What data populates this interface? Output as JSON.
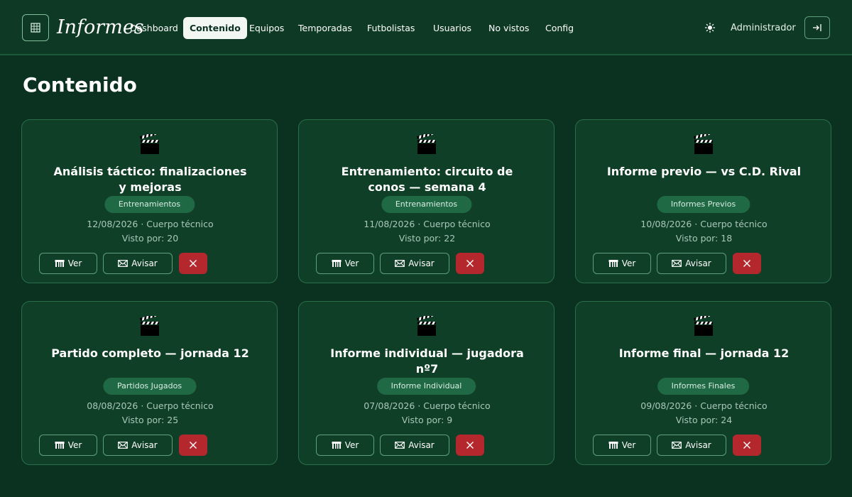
{
  "header": {
    "brand": "Informes",
    "nav": [
      {
        "label": "Dashboard"
      },
      {
        "label": "Contenido"
      },
      {
        "label": "Equipos"
      },
      {
        "label": "Temporadas"
      },
      {
        "label": "Futbolistas"
      },
      {
        "label": "Usuarios"
      },
      {
        "label": "No vistos"
      },
      {
        "label": "Config"
      }
    ],
    "user": "Administrador",
    "icons": {
      "logo": "grid-icon",
      "theme": "sun-icon",
      "logout": "logout-icon"
    }
  },
  "page": {
    "title": "Contenido"
  },
  "actions": {
    "ver": "Ver",
    "avisar": "Avisar"
  },
  "cards": [
    {
      "title": "Análisis táctico: finalizaciones y mejoras",
      "category": "Entrenamientos",
      "meta": "12/08/2026 · Cuerpo técnico",
      "views": "Visto por: 20"
    },
    {
      "title": "Entrenamiento: circuito de conos — semana 4",
      "category": "Entrenamientos",
      "meta": "11/08/2026 · Cuerpo técnico",
      "views": "Visto por: 22"
    },
    {
      "title": "Informe previo — vs C.D. Rival",
      "category": "Informes Previos",
      "meta": "10/08/2026 · Cuerpo técnico",
      "views": "Visto por: 18"
    },
    {
      "title": "Partido completo — jornada 12",
      "category": "Partidos Jugados",
      "meta": "08/08/2026 · Cuerpo técnico",
      "views": "Visto por: 25"
    },
    {
      "title": "Informe individual — jugadora nº7",
      "category": "Informe Individual",
      "meta": "07/08/2026 · Cuerpo técnico",
      "views": "Visto por: 9"
    },
    {
      "title": "Informe final — jornada 12",
      "category": "Informes Finales",
      "meta": "09/08/2026 · Cuerpo técnico",
      "views": "Visto por: 24"
    }
  ]
}
